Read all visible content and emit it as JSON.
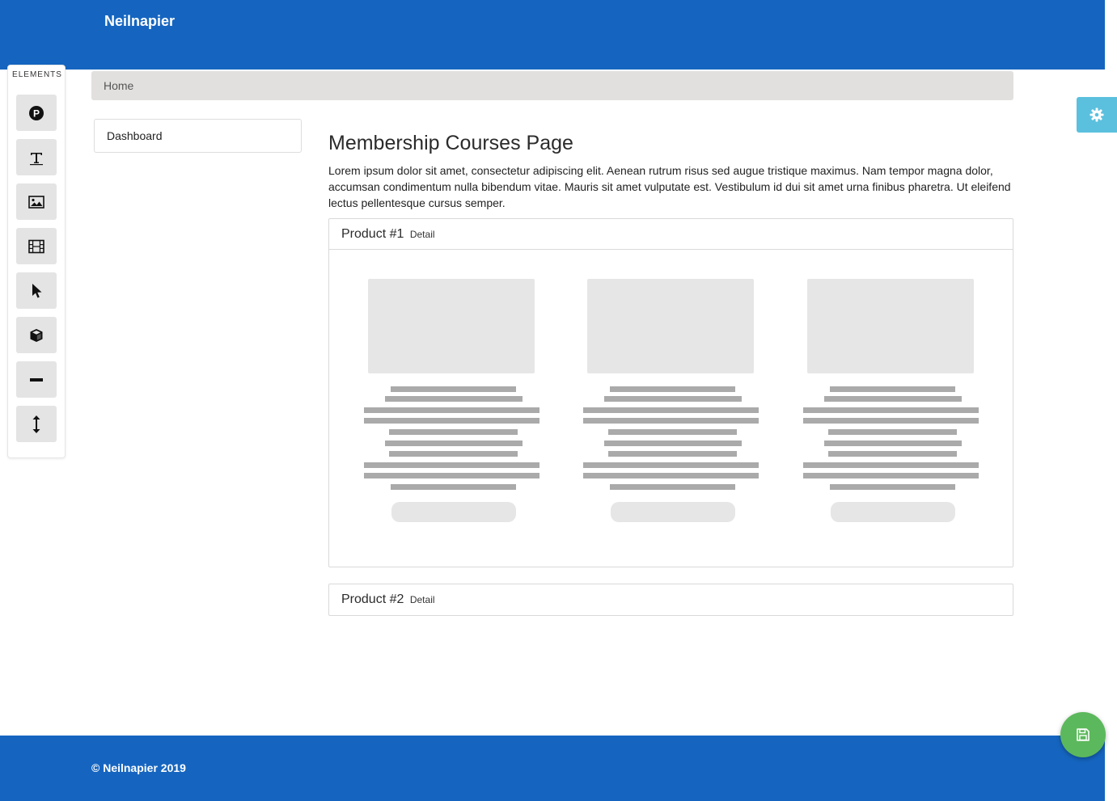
{
  "header": {
    "brand": "Neilnapier",
    "color": "#1565c0"
  },
  "elements_panel": {
    "title": "ELEMENTS",
    "items": [
      {
        "icon": "p-circle-icon"
      },
      {
        "icon": "text-icon"
      },
      {
        "icon": "image-icon"
      },
      {
        "icon": "film-icon"
      },
      {
        "icon": "pointer-icon"
      },
      {
        "icon": "cube-icon"
      },
      {
        "icon": "divider-icon"
      },
      {
        "icon": "spacer-icon"
      }
    ]
  },
  "breadcrumb": {
    "home": "Home"
  },
  "settings": {
    "icon": "gear-icon",
    "color": "#5bc0de"
  },
  "sidebar": {
    "items": [
      {
        "label": "Dashboard"
      }
    ]
  },
  "main": {
    "title": "Membership Courses Page",
    "lead": "Lorem ipsum dolor sit amet, consectetur adipiscing elit. Aenean rutrum risus sed augue tristique maximus. Nam tempor magna dolor, accumsan condimentum nulla bibendum vitae. Mauris sit amet vulputate est. Vestibulum id dui sit amet urna finibus pharetra. Ut eleifend lectus pellentesque cursus semper.",
    "products": [
      {
        "title": "Product #1",
        "detail": "Detail"
      },
      {
        "title": "Product #2",
        "detail": "Detail"
      }
    ]
  },
  "footer": {
    "copyright": "© Neilnapier 2019"
  },
  "save_button": {
    "icon": "floppy-disk-icon",
    "color": "#5cb85c"
  }
}
